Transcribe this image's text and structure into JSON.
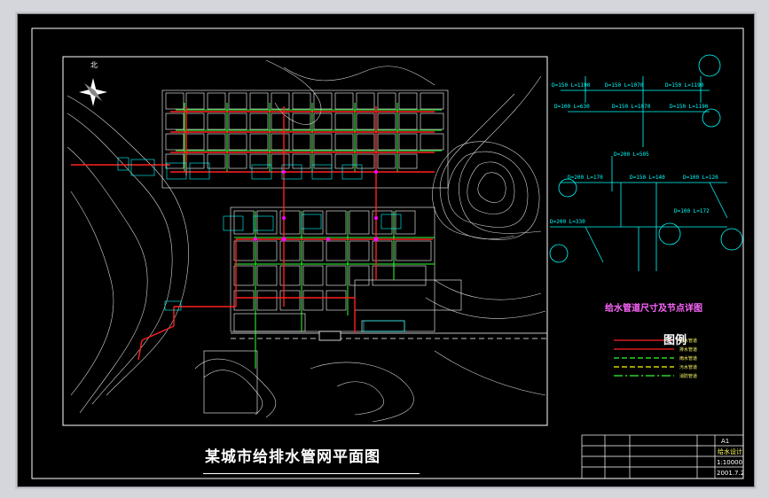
{
  "drawing": {
    "title": "某城市给排水管网平面图",
    "north": "北",
    "node_detail_title": "给水管道尺寸及节点详图",
    "legend_title": "图例"
  },
  "title_block": {
    "row1_a": "A1",
    "row1_b": "给水设计",
    "row2_scale": "1:10000",
    "date": "2001.7.2"
  },
  "colors": {
    "background": "#000000",
    "frame": "#ffffff",
    "water_supply_pipe": "#ff2020",
    "drainage_pipe": "#33ff33",
    "road": "#ffffff",
    "contour": "#ffffff",
    "node_detail": "#00ffff",
    "annotation": "#ffff00",
    "node_marker": "#ff00ff"
  }
}
